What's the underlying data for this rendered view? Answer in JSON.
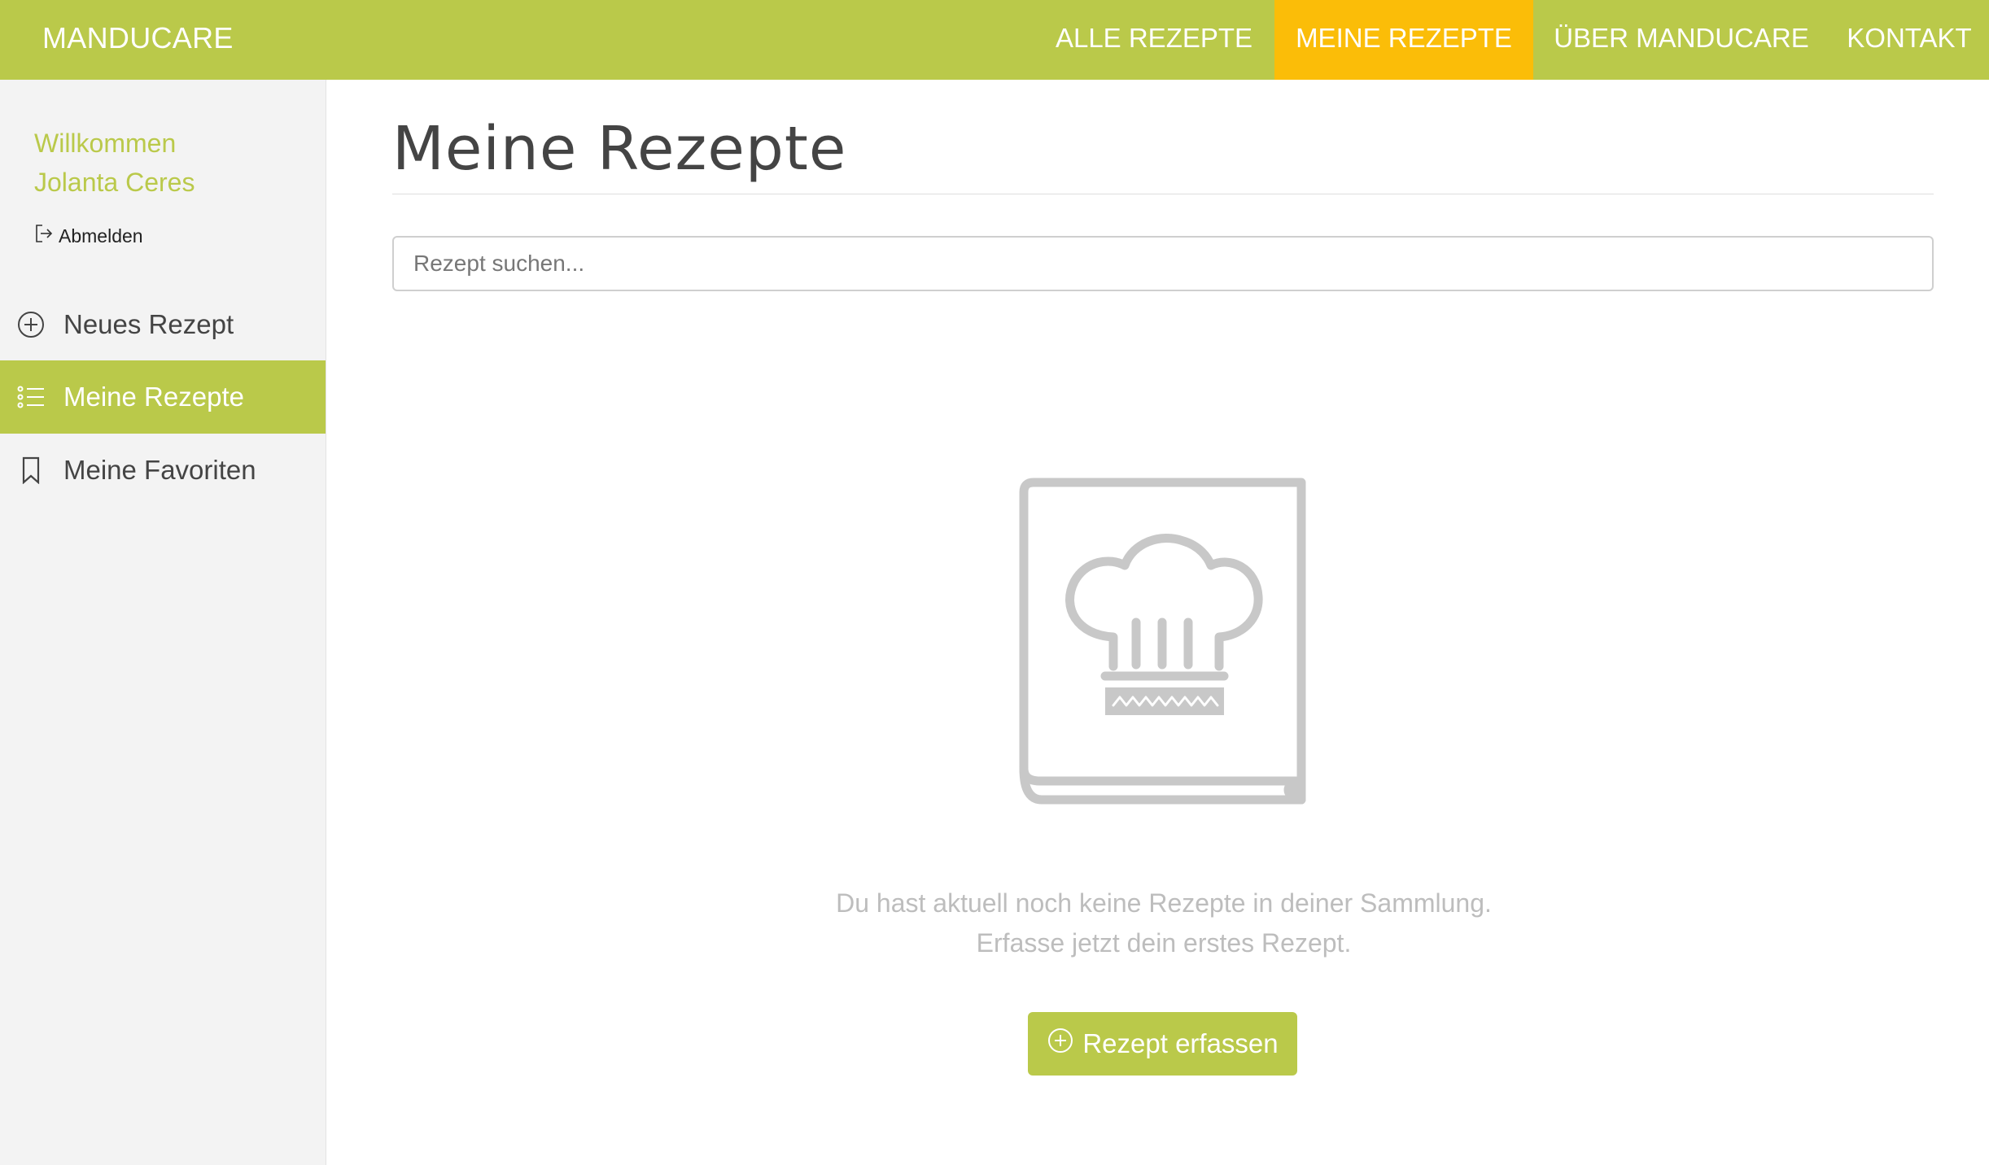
{
  "header": {
    "brand": "MANDUCARE",
    "nav": [
      {
        "label": "ALLE REZEPTE",
        "active": false
      },
      {
        "label": "MEINE REZEPTE",
        "active": true
      },
      {
        "label": "ÜBER MANDUCARE",
        "active": false
      },
      {
        "label": "KONTAKT",
        "active": false
      }
    ]
  },
  "sidebar": {
    "welcome_line1": "Willkommen",
    "welcome_line2": "Jolanta Ceres",
    "logout_label": "Abmelden",
    "items": [
      {
        "label": "Neues Rezept",
        "icon": "plus-circle-icon",
        "active": false
      },
      {
        "label": "Meine Rezepte",
        "icon": "list-icon",
        "active": true
      },
      {
        "label": "Meine Favoriten",
        "icon": "bookmark-icon",
        "active": false
      }
    ]
  },
  "main": {
    "title": "Meine Rezepte",
    "search_placeholder": "Rezept suchen...",
    "empty_line1": "Du hast aktuell noch keine Rezepte in deiner Sammlung.",
    "empty_line2": "Erfasse jetzt dein erstes Rezept.",
    "create_button": "Rezept erfassen",
    "illustration": "cookbook-chef-hat-icon"
  },
  "colors": {
    "brand_green": "#bac94a",
    "active_nav": "#fbbd08",
    "sidebar_bg": "#f3f3f3",
    "muted_text": "#bdbdbd"
  }
}
